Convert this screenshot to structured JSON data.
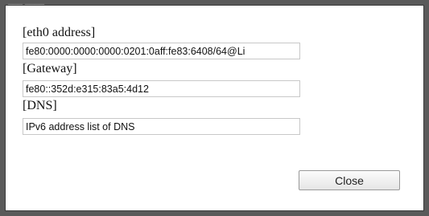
{
  "header": {
    "partial_text": "___ ____"
  },
  "dialog": {
    "fields": [
      {
        "label": "[eth0 address]",
        "value": "fe80:0000:0000:0000:0201:0aff:fe83:6408/64@Li"
      },
      {
        "label": "[Gateway]",
        "value": "fe80::352d:e315:83a5:4d12"
      },
      {
        "label": "[DNS]",
        "value": "IPv6 address list of DNS"
      }
    ],
    "close_label": "Close"
  }
}
